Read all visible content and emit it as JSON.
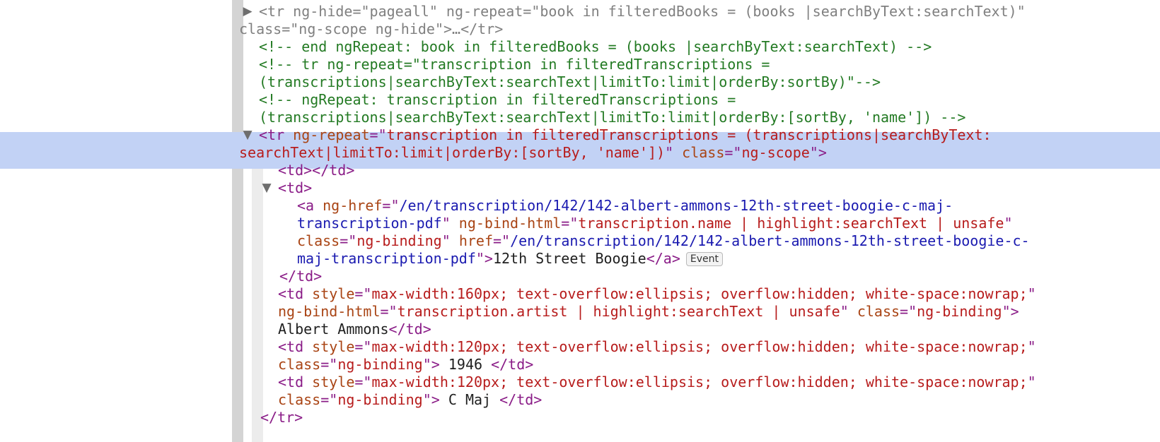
{
  "elements_tree": {
    "selected_node": "tr.ng-scope (transcription row)",
    "event_badge": "Event",
    "lines": [
      {
        "kind": "hidden-tr",
        "tokens": [
          {
            "t": "<tr ",
            "c": "dim"
          },
          {
            "t": "ng-hide=\"pageall\" ng-repeat=\"book in filteredBooks = (books |searchByText:searchText)\"",
            "c": "dim"
          }
        ]
      },
      {
        "kind": "hidden-tr-cont",
        "tokens": [
          {
            "t": "class=\"ng-scope ng-hide\">…</tr>",
            "c": "dim"
          }
        ]
      },
      {
        "kind": "comment",
        "tokens": [
          {
            "t": "<!-- end ngRepeat: book in filteredBooks = (books |searchByText:searchText) -->",
            "c": "cm"
          }
        ]
      },
      {
        "kind": "comment",
        "tokens": [
          {
            "t": "<!-- tr ng-repeat=\"transcription in filteredTranscriptions =",
            "c": "cm"
          }
        ]
      },
      {
        "kind": "comment",
        "tokens": [
          {
            "t": "(transcriptions|searchByText:searchText|limitTo:limit|orderBy:sortBy)\"-->",
            "c": "cm"
          }
        ]
      },
      {
        "kind": "comment",
        "tokens": [
          {
            "t": "<!-- ngRepeat: transcription in filteredTranscriptions =",
            "c": "cm"
          }
        ]
      },
      {
        "kind": "comment",
        "tokens": [
          {
            "t": "(transcriptions|searchByText:searchText|limitTo:limit|orderBy:[sortBy, 'name']) -->",
            "c": "cm"
          }
        ]
      },
      {
        "kind": "selected-tr",
        "tokens": [
          {
            "t": "<tr ",
            "c": "tag"
          },
          {
            "t": "ng-repeat",
            "c": "an"
          },
          {
            "t": "=\"",
            "c": "tag"
          },
          {
            "t": "transcription in filteredTranscriptions = (transcriptions|searchByText:",
            "c": "av"
          }
        ]
      },
      {
        "kind": "selected-tr-cont",
        "tokens": [
          {
            "t": "searchText|limitTo:limit|orderBy:[sortBy, 'name'])",
            "c": "av"
          },
          {
            "t": "\" ",
            "c": "tag"
          },
          {
            "t": "class",
            "c": "an"
          },
          {
            "t": "=\"",
            "c": "tag"
          },
          {
            "t": "ng-scope",
            "c": "av"
          },
          {
            "t": "\">",
            "c": "tag"
          }
        ]
      },
      {
        "kind": "td-empty",
        "tokens": [
          {
            "t": "<td></td>",
            "c": "tag"
          }
        ]
      },
      {
        "kind": "td-open",
        "tokens": [
          {
            "t": "<td>",
            "c": "tag"
          }
        ]
      },
      {
        "kind": "anchor",
        "tokens": [
          {
            "t": "<a ",
            "c": "tag"
          },
          {
            "t": "ng-href",
            "c": "an"
          },
          {
            "t": "=\"",
            "c": "tag"
          },
          {
            "t": "/en/transcription/142/142-albert-ammons-12th-street-boogie-c-maj-",
            "c": "url"
          }
        ]
      },
      {
        "kind": "anchor-cont",
        "tokens": [
          {
            "t": "transcription-pdf",
            "c": "url"
          },
          {
            "t": "\" ",
            "c": "tag"
          },
          {
            "t": "ng-bind-html",
            "c": "an"
          },
          {
            "t": "=\"",
            "c": "tag"
          },
          {
            "t": "transcription.name | highlight:searchText | unsafe",
            "c": "av"
          },
          {
            "t": "\"",
            "c": "tag"
          }
        ]
      },
      {
        "kind": "anchor-cont",
        "tokens": [
          {
            "t": "class",
            "c": "an"
          },
          {
            "t": "=\"",
            "c": "tag"
          },
          {
            "t": "ng-binding",
            "c": "av"
          },
          {
            "t": "\" ",
            "c": "tag"
          },
          {
            "t": "href",
            "c": "an"
          },
          {
            "t": "=\"",
            "c": "tag"
          },
          {
            "t": "/en/transcription/142/142-albert-ammons-12th-street-boogie-c-",
            "c": "url"
          }
        ]
      },
      {
        "kind": "anchor-end",
        "tokens": [
          {
            "t": "maj-transcription-pdf",
            "c": "url"
          },
          {
            "t": "\">",
            "c": "tag"
          },
          {
            "t": "12th Street Boogie",
            "c": "tx"
          },
          {
            "t": "</a>",
            "c": "tag"
          }
        ]
      },
      {
        "kind": "td-close",
        "tokens": [
          {
            "t": "</td>",
            "c": "tag"
          }
        ]
      },
      {
        "kind": "td-style",
        "tokens": [
          {
            "t": "<td ",
            "c": "tag"
          },
          {
            "t": "style",
            "c": "an"
          },
          {
            "t": "=\"",
            "c": "tag"
          },
          {
            "t": "max-width:160px; text-overflow:ellipsis; overflow:hidden; white-space:nowrap;",
            "c": "av"
          },
          {
            "t": "\"",
            "c": "tag"
          }
        ]
      },
      {
        "kind": "td-style-cont",
        "tokens": [
          {
            "t": "ng-bind-html",
            "c": "an"
          },
          {
            "t": "=\"",
            "c": "tag"
          },
          {
            "t": "transcription.artist | highlight:searchText | unsafe",
            "c": "av"
          },
          {
            "t": "\" ",
            "c": "tag"
          },
          {
            "t": "class",
            "c": "an"
          },
          {
            "t": "=\"",
            "c": "tag"
          },
          {
            "t": "ng-binding",
            "c": "av"
          },
          {
            "t": "\">",
            "c": "tag"
          }
        ]
      },
      {
        "kind": "td-text",
        "tokens": [
          {
            "t": "Albert Ammons",
            "c": "tx"
          },
          {
            "t": "</td>",
            "c": "tag"
          }
        ]
      },
      {
        "kind": "td-style",
        "tokens": [
          {
            "t": "<td ",
            "c": "tag"
          },
          {
            "t": "style",
            "c": "an"
          },
          {
            "t": "=\"",
            "c": "tag"
          },
          {
            "t": "max-width:120px; text-overflow:ellipsis; overflow:hidden; white-space:nowrap;",
            "c": "av"
          },
          {
            "t": "\"",
            "c": "tag"
          }
        ]
      },
      {
        "kind": "td-style-cont",
        "tokens": [
          {
            "t": "class",
            "c": "an"
          },
          {
            "t": "=\"",
            "c": "tag"
          },
          {
            "t": "ng-binding",
            "c": "av"
          },
          {
            "t": "\">",
            "c": "tag"
          },
          {
            "t": " 1946 ",
            "c": "tx"
          },
          {
            "t": "</td>",
            "c": "tag"
          }
        ]
      },
      {
        "kind": "td-style",
        "tokens": [
          {
            "t": "<td ",
            "c": "tag"
          },
          {
            "t": "style",
            "c": "an"
          },
          {
            "t": "=\"",
            "c": "tag"
          },
          {
            "t": "max-width:120px; text-overflow:ellipsis; overflow:hidden; white-space:nowrap;",
            "c": "av"
          },
          {
            "t": "\"",
            "c": "tag"
          }
        ]
      },
      {
        "kind": "td-style-cont",
        "tokens": [
          {
            "t": "class",
            "c": "an"
          },
          {
            "t": "=\"",
            "c": "tag"
          },
          {
            "t": "ng-binding",
            "c": "av"
          },
          {
            "t": "\">",
            "c": "tag"
          },
          {
            "t": " C Maj ",
            "c": "tx"
          },
          {
            "t": "</td>",
            "c": "tag"
          }
        ]
      },
      {
        "kind": "tr-close",
        "tokens": [
          {
            "t": "</tr>",
            "c": "tag"
          }
        ]
      }
    ]
  }
}
